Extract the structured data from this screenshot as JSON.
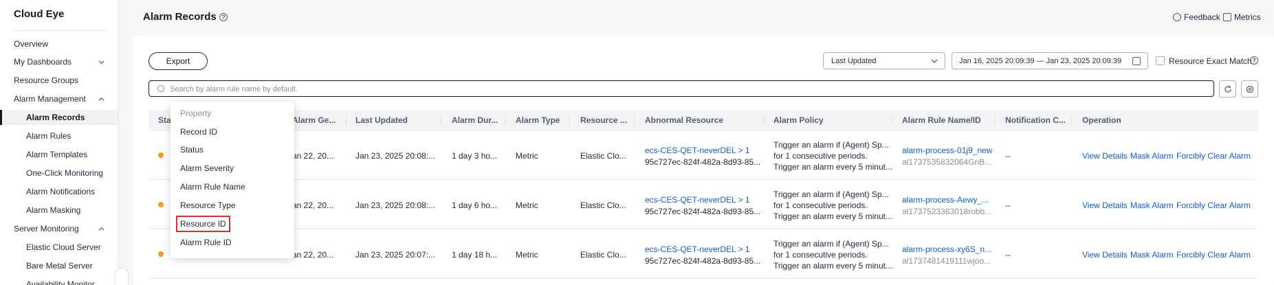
{
  "sidebar": {
    "title": "Cloud Eye",
    "items": [
      {
        "label": "Overview"
      },
      {
        "label": "My Dashboards"
      },
      {
        "label": "Resource Groups"
      },
      {
        "label": "Alarm Management"
      },
      {
        "label": "Alarm Records"
      },
      {
        "label": "Alarm Rules"
      },
      {
        "label": "Alarm Templates"
      },
      {
        "label": "One-Click Monitoring"
      },
      {
        "label": "Alarm Notifications"
      },
      {
        "label": "Alarm Masking"
      },
      {
        "label": "Server Monitoring"
      },
      {
        "label": "Elastic Cloud Server"
      },
      {
        "label": "Bare Metal Server"
      },
      {
        "label": "Availability Monitor"
      }
    ]
  },
  "header": {
    "title": "Alarm Records",
    "feedback": "Feedback",
    "metrics": "Metrics"
  },
  "toolbar": {
    "export_label": "Export",
    "sort_value": "Last Updated",
    "date_range": "Jan 16, 2025 20:09:39 — Jan 23, 2025 20:09:39",
    "exact_match_label": "Resource Exact Match",
    "search_placeholder": "Search by alarm rule name by default."
  },
  "table": {
    "columns": [
      "Sta",
      "Alarm Ge...",
      "Last Updated",
      "Alarm Dur...",
      "Alarm Type",
      "Resource ...",
      "Abnormal Resource",
      "Alarm Policy",
      "Alarm Rule Name/ID",
      "Notification C...",
      "Operation"
    ],
    "rows": [
      {
        "generated": "an 22, 20...",
        "updated": "Jan 23, 2025 20:08:...",
        "duration": "1 day 3 ho...",
        "type": "Metric",
        "resource_type": "Elastic Clo...",
        "resource_name": "ecs-CES-QET-neverDEL > 1",
        "resource_id": "95c727ec-824f-482a-8d93-85...",
        "policy_1": "Trigger an alarm if (Agent) Sp...",
        "policy_2": "for 1 consecutive periods.",
        "policy_3": "Trigger an alarm every 5 minut...",
        "rule_name": "alarm-process-01j9_new",
        "rule_id": "al1737535832064GnB...",
        "notification": "--"
      },
      {
        "generated": "an 22, 20...",
        "updated": "Jan 23, 2025 20:08:...",
        "duration": "1 day 6 ho...",
        "type": "Metric",
        "resource_type": "Elastic Clo...",
        "resource_name": "ecs-CES-QET-neverDEL > 1",
        "resource_id": "95c727ec-824f-482a-8d93-85...",
        "policy_1": "Trigger an alarm if (Agent) Sp...",
        "policy_2": "for 1 consecutive periods.",
        "policy_3": "Trigger an alarm every 5 minut...",
        "rule_name": "alarm-process-Aewy_...",
        "rule_id": "al1737523363018robb...",
        "notification": "--"
      },
      {
        "generated": "an 22, 20...",
        "updated": "Jan 23, 2025 20:07:...",
        "duration": "1 day 18 h...",
        "type": "Metric",
        "resource_type": "Elastic Clo...",
        "resource_name": "ecs-CES-QET-neverDEL > 1",
        "resource_id": "95c727ec-824f-482a-8d93-85...",
        "policy_1": "Trigger an alarm if (Agent) Sp...",
        "policy_2": "for 1 consecutive periods.",
        "policy_3": "Trigger an alarm every 5 minut...",
        "rule_name": "alarm-process-xy6S_n...",
        "rule_id": "al1737481419111wjoo...",
        "notification": "--"
      }
    ],
    "operations": [
      "View Details",
      "Mask Alarm",
      "Forcibly Clear Alarm"
    ]
  },
  "property_dropdown": {
    "header": "Property",
    "items": [
      "Record ID",
      "Status",
      "Alarm Severity",
      "Alarm Rule Name",
      "Resource Type",
      "Resource ID",
      "Alarm Rule ID"
    ],
    "highlighted": "Resource ID"
  },
  "colors": {
    "accent_link": "#0d5fd8",
    "status_dot": "#f59a23",
    "highlight_border": "#e02d30"
  }
}
